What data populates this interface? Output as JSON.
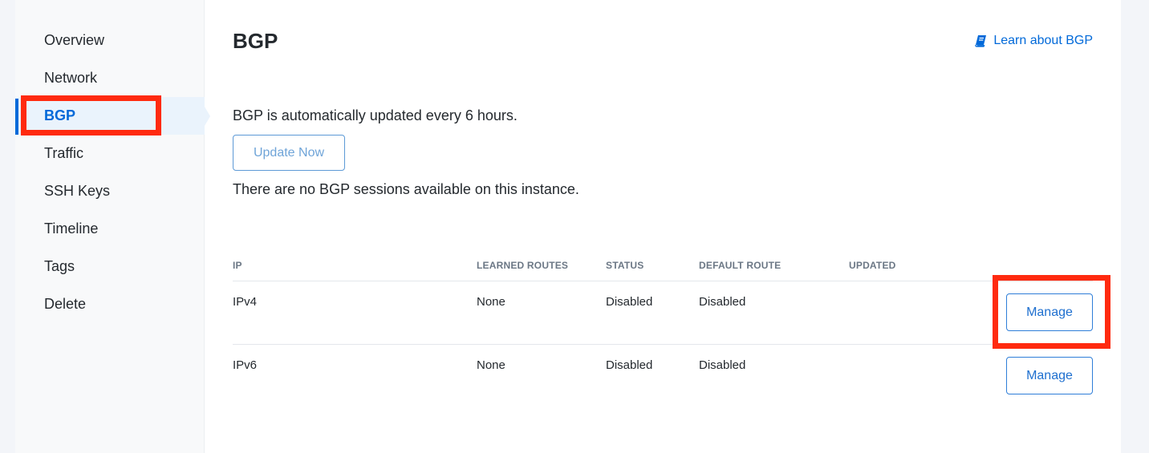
{
  "sidebar": {
    "items": [
      {
        "label": "Overview"
      },
      {
        "label": "Network"
      },
      {
        "label": "BGP"
      },
      {
        "label": "Traffic"
      },
      {
        "label": "SSH Keys"
      },
      {
        "label": "Timeline"
      },
      {
        "label": "Tags"
      },
      {
        "label": "Delete"
      }
    ],
    "active_index": 2
  },
  "main": {
    "title": "BGP",
    "learn_link": "Learn about BGP",
    "info": "BGP is automatically updated every 6 hours.",
    "update_button": "Update Now",
    "empty_message": "There are no BGP sessions available on this instance.",
    "table": {
      "headers": [
        "IP",
        "LEARNED ROUTES",
        "STATUS",
        "DEFAULT ROUTE",
        "UPDATED"
      ],
      "rows": [
        {
          "ip": "IPv4",
          "learned_routes": "None",
          "status": "Disabled",
          "default_route": "Disabled",
          "updated": "",
          "action": "Manage"
        },
        {
          "ip": "IPv6",
          "learned_routes": "None",
          "status": "Disabled",
          "default_route": "Disabled",
          "updated": "",
          "action": "Manage"
        }
      ]
    }
  },
  "colors": {
    "accent": "#0069d9",
    "highlight": "#ff2a0f"
  },
  "icons": {
    "learn_link": "book-icon"
  }
}
